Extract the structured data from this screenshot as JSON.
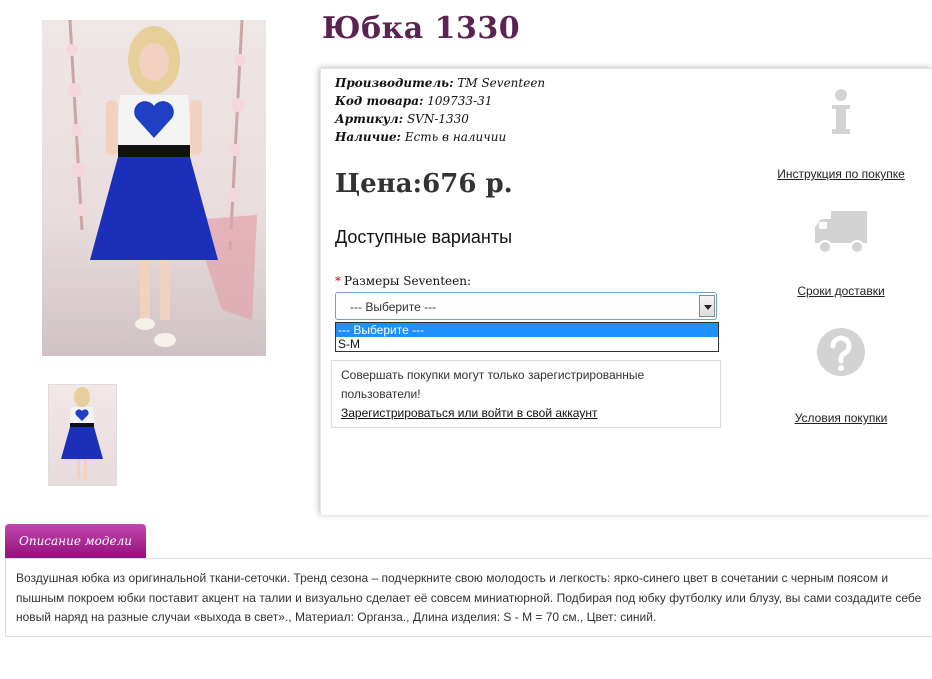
{
  "product": {
    "title": "Юбка 1330",
    "main_image_alt": "skirt-model-photo",
    "thumbnail_alt": "skirt-model-thumbnail"
  },
  "meta": {
    "manufacturer_label": "Производитель:",
    "manufacturer_value": "ТМ Seventeen",
    "code_label": "Код товара:",
    "code_value": "109733-31",
    "article_label": "Артикул:",
    "article_value": "SVN-1330",
    "availability_label": "Наличие:",
    "availability_value": "Есть в наличии"
  },
  "price": "Цена:676 р.",
  "variants": {
    "title": "Доступные варианты",
    "required_mark": "*",
    "size_label": "Размеры Seventeen:",
    "select_value": "--- Выберите ---",
    "options": [
      "--- Выберите ---",
      "S-M"
    ]
  },
  "notice": {
    "text": "Совершать покупки могут только зарегистрированные пользователи!",
    "link": "Зарегистрироваться или войти в свой аккаунт"
  },
  "side_links": {
    "instruction": "Инструкция по покупке",
    "delivery": "Сроки доставки",
    "terms": "Условия покупки"
  },
  "icons": {
    "info": "info-icon",
    "truck": "truck-icon",
    "question": "question-icon",
    "color": "#d3d3d3"
  },
  "description": {
    "tab_label": "Описание модели",
    "text": "Воздушная юбка из оригинальной ткани-сеточки. Тренд сезона – подчеркните свою молодость и легкость: ярко-синего цвет в сочетании с черным поясом и пышным покроем юбки поставит акцент на талии и визуально сделает её совсем миниатюрной. Подбирая под юбку футболку или блузу, вы сами создадите себе новый наряд на разные случаи «выхода в свет»., Материал: Органза., Длина изделия: S - M = 70 см., Цвет: синий."
  },
  "colors": {
    "title": "#5a2352",
    "tab": "#a81d94",
    "select_highlight": "#1e90ff",
    "skirt": "#1b2fb8"
  }
}
